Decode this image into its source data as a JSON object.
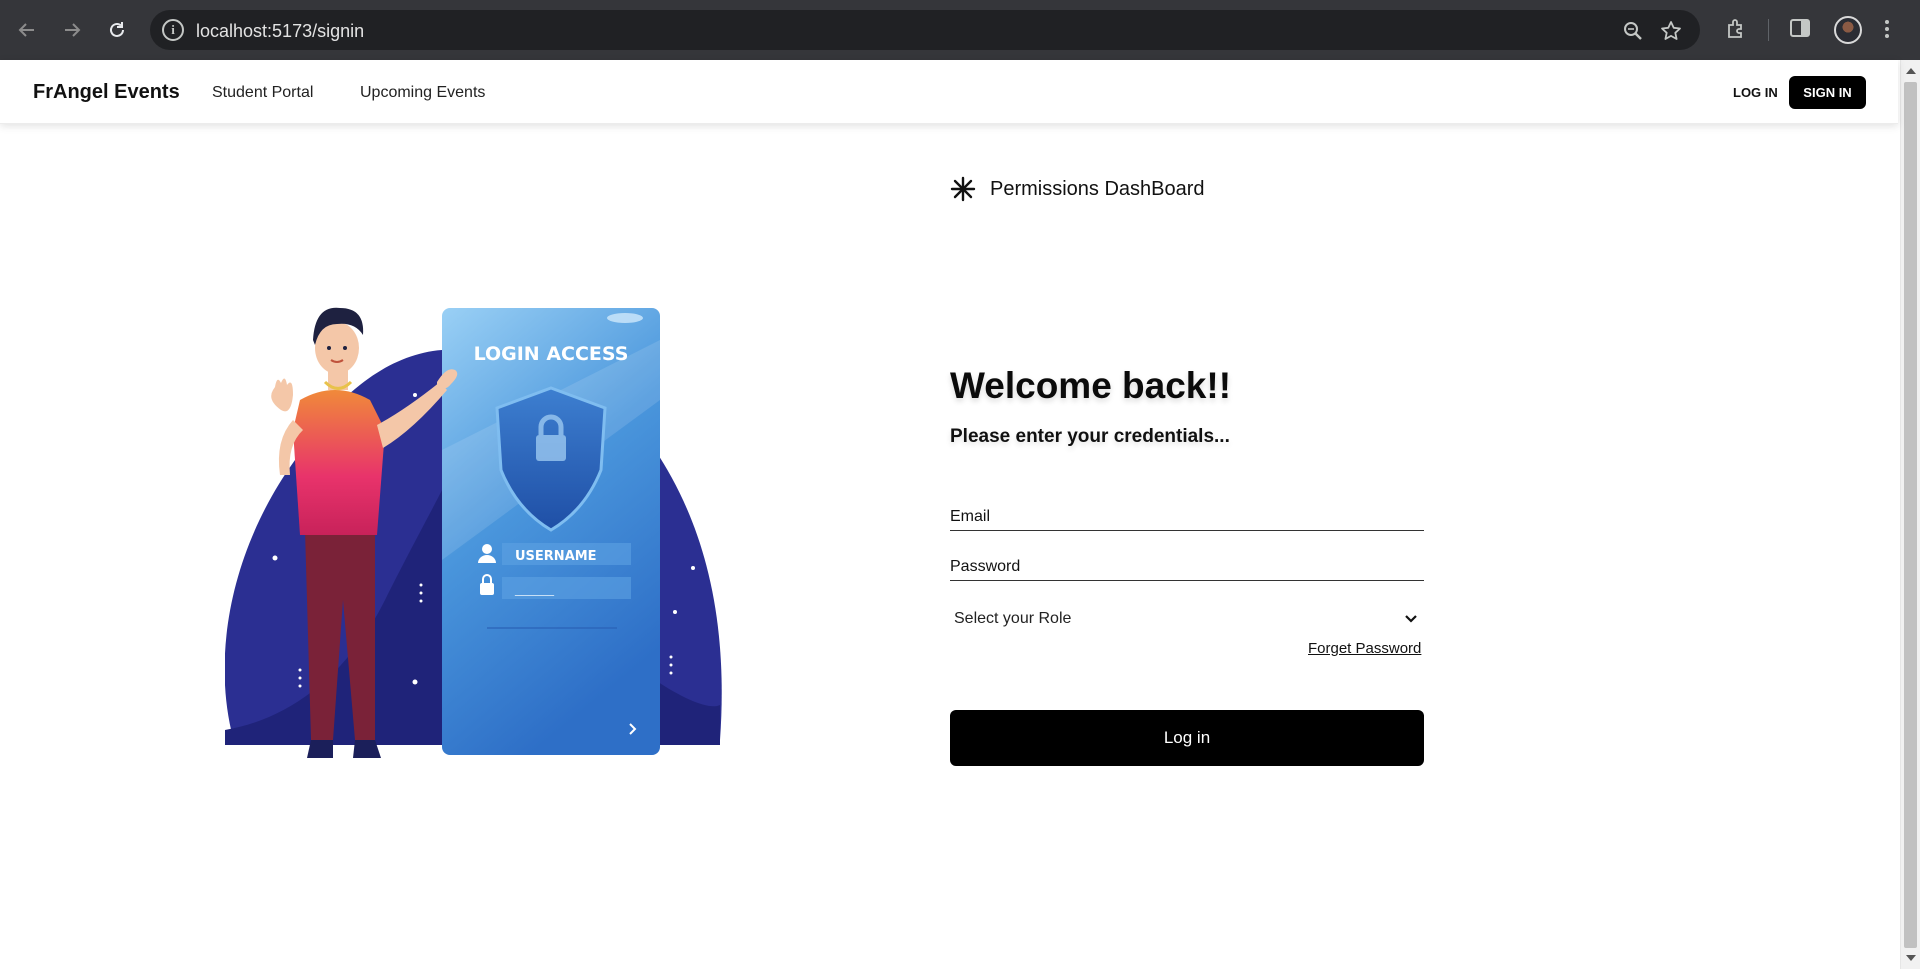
{
  "browser": {
    "url": "localhost:5173/signin",
    "icons": [
      "back-icon",
      "forward-icon",
      "reload-icon",
      "site-info-icon",
      "zoom-icon",
      "bookmark-star-icon",
      "extensions-icon",
      "side-panel-icon",
      "profile-avatar",
      "menu-dots-icon"
    ]
  },
  "header": {
    "brand": "FrAngel Events",
    "nav": [
      "Student Portal",
      "Upcoming Events"
    ],
    "login_label": "LOG IN",
    "signin_label": "SIGN IN"
  },
  "illustration": {
    "title": "LOGIN ACCESS",
    "username_label": "USERNAME",
    "password_mask": "______"
  },
  "form": {
    "dashboard_title": "Permissions DashBoard",
    "heading": "Welcome back!!",
    "subheading": "Please enter your credentials...",
    "email_placeholder": "Email",
    "password_placeholder": "Password",
    "role_selected": "Select your Role",
    "forget_label": "Forget Password",
    "submit_label": "Log in"
  },
  "colors": {
    "accent": "#000000",
    "illustration_blob": "#2a2e8f",
    "panel_blue": "#3f8fdc"
  }
}
